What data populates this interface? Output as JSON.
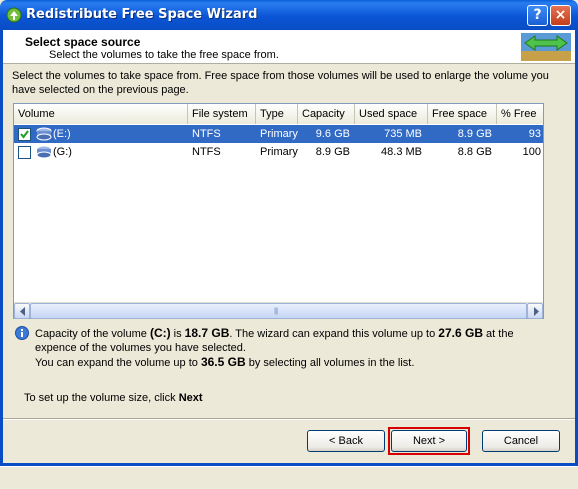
{
  "window": {
    "title": "Redistribute Free Space Wizard",
    "help_label": "?",
    "close_label": "×"
  },
  "header": {
    "title": "Select space source",
    "subtitle": "Select the volumes to take the free space from."
  },
  "description": "Select the volumes to take space from. Free space from those volumes will be used to enlarge the volume you have selected on the previous page.",
  "table": {
    "columns": [
      "Volume",
      "File system",
      "Type",
      "Capacity",
      "Used space",
      "Free space",
      "% Free"
    ],
    "rows": [
      {
        "checked": true,
        "volume": "(E:)",
        "fs": "NTFS",
        "type": "Primary",
        "capacity": "9.6 GB",
        "used": "735 MB",
        "free": "8.9 GB",
        "pct": "93",
        "selected": true
      },
      {
        "checked": false,
        "volume": "(G:)",
        "fs": "NTFS",
        "type": "Primary",
        "capacity": "8.9 GB",
        "used": "48.3 MB",
        "free": "8.8 GB",
        "pct": "100",
        "selected": false
      }
    ]
  },
  "info": {
    "p1": "Capacity of the volume ",
    "vol": "(C:)",
    "p2": " is ",
    "cap": "18.7 GB",
    "p3": ". The wizard can expand this volume up to ",
    "max": "27.6 GB",
    "p4": " at the expence of the volumes you have selected.",
    "p5": "You can expand the volume up to ",
    "all": "36.5 GB",
    "p6": " by selecting all volumes in the list."
  },
  "setup": {
    "text": "To set up the volume size, click ",
    "bold": "Next"
  },
  "buttons": {
    "back": "< Back",
    "next": "Next >",
    "cancel": "Cancel"
  },
  "icons": {
    "app": "wizard-icon",
    "info": "info-icon",
    "volume": "disk-icon",
    "header_art": "redistribute-arrows-icon"
  }
}
